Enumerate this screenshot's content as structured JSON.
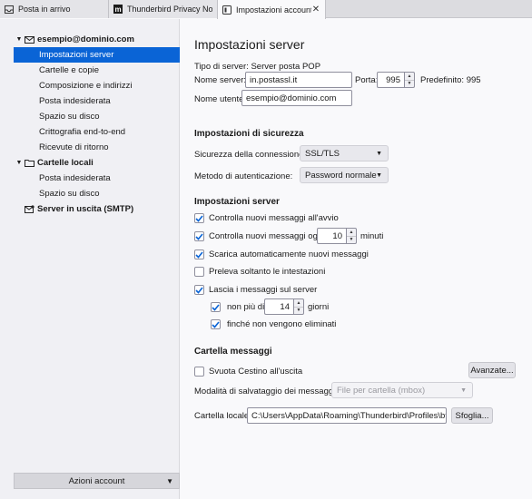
{
  "tabs": [
    {
      "label": "Posta in arrivo",
      "icon": "inbox-icon",
      "active": false
    },
    {
      "label": "Thunderbird Privacy Notice",
      "icon": "mozilla-icon",
      "active": false
    },
    {
      "label": "Impostazioni account",
      "icon": "settings-icon",
      "active": true
    }
  ],
  "sidebar": {
    "account": "esempio@dominio.com",
    "account_items": [
      "Impostazioni server",
      "Cartelle e copie",
      "Composizione e indirizzi",
      "Posta indesiderata",
      "Spazio su disco",
      "Crittografia end-to-end",
      "Ricevute di ritorno"
    ],
    "local_folders": "Cartelle locali",
    "local_items": [
      "Posta indesiderata",
      "Spazio su disco"
    ],
    "outgoing": "Server in uscita (SMTP)",
    "actions_label": "Azioni account"
  },
  "main": {
    "title": "Impostazioni server",
    "server_type": "Tipo di server: Server posta POP",
    "server_name_label": "Nome server:",
    "server_name_value": "in.postassl.it",
    "port_label": "Porta:",
    "port_value": "995",
    "default_port": "Predefinito: 995",
    "username_label": "Nome utente:",
    "username_value": "esempio@dominio.com",
    "security": {
      "heading": "Impostazioni di sicurezza",
      "connection_label": "Sicurezza della connessione:",
      "connection_value": "SSL/TLS",
      "auth_label": "Metodo di autenticazione:",
      "auth_value": "Password normale"
    },
    "server_settings": {
      "heading": "Impostazioni server",
      "check_startup": "Controlla nuovi messaggi all'avvio",
      "check_every": "Controlla nuovi messaggi ogni",
      "check_every_value": "10",
      "minutes": "minuti",
      "auto_download": "Scarica automaticamente nuovi messaggi",
      "headers_only": "Preleva soltanto le intestazioni",
      "leave_on_server": "Lascia i messaggi sul server",
      "no_more_than": "non più di",
      "days_value": "14",
      "days": "giorni",
      "until_deleted": "finché non vengono eliminati"
    },
    "folder": {
      "heading": "Cartella messaggi",
      "empty_trash": "Svuota Cestino all'uscita",
      "advanced_button": "Avanzate...",
      "storage_label": "Modalità di salvataggio dei messaggi:",
      "storage_value": "File per cartella (mbox)",
      "local_dir_label": "Cartella locale:",
      "local_dir_value": "C:\\Users\\AppData\\Roaming\\Thunderbird\\Profiles\\btwo",
      "browse_button": "Sfoglia..."
    }
  },
  "colors": {
    "selection": "#0a64d6",
    "checkbox": "#0a64d6"
  }
}
